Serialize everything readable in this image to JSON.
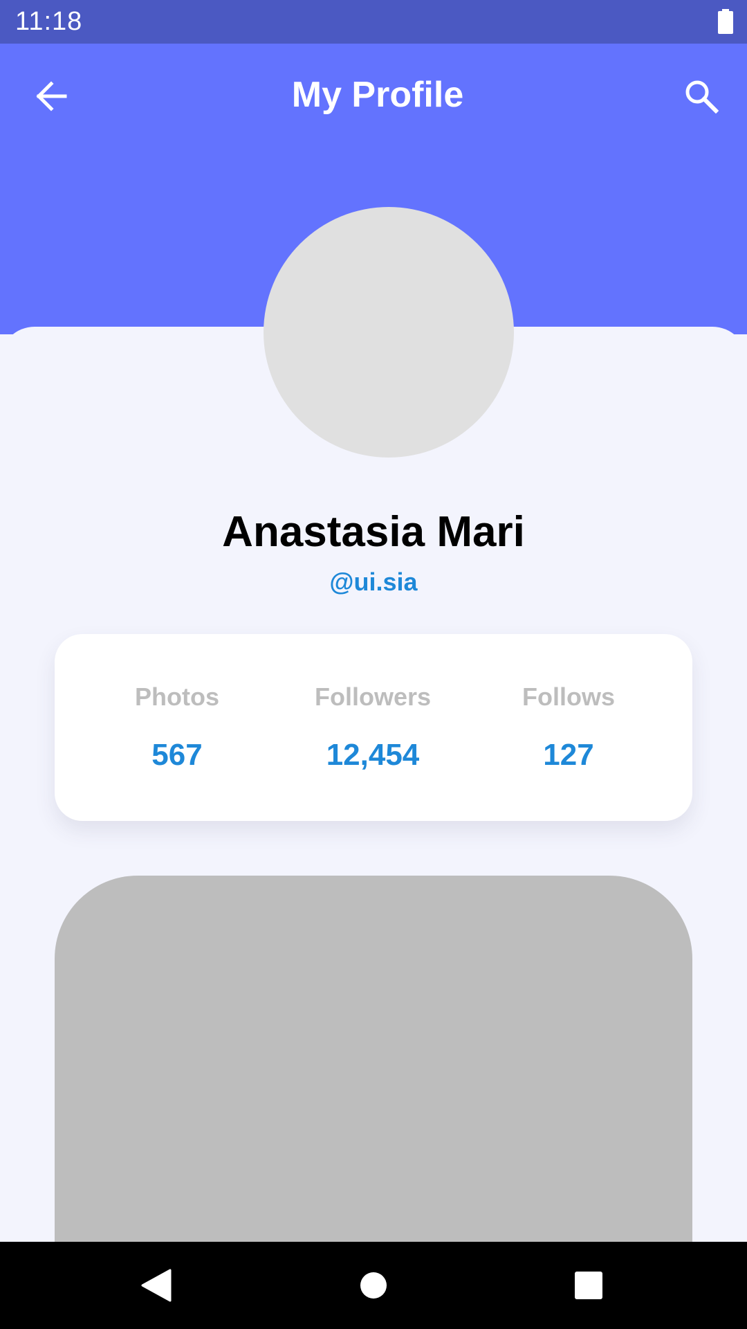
{
  "status_bar": {
    "time": "11:18",
    "battery_icon": "battery-full-icon"
  },
  "header": {
    "title": "My Profile",
    "back_icon": "arrow-back-icon",
    "search_icon": "search-icon",
    "background_color": "#6373FE"
  },
  "profile": {
    "name": "Anastasia Mari",
    "handle": "@ui.sia"
  },
  "stats": [
    {
      "label": "Photos",
      "value": "567"
    },
    {
      "label": "Followers",
      "value": "12,454"
    },
    {
      "label": "Follows",
      "value": "127"
    }
  ],
  "nav_bar": {
    "back_icon": "nav-back-triangle-icon",
    "home_icon": "nav-home-circle-icon",
    "recents_icon": "nav-recents-square-icon"
  },
  "colors": {
    "status_bar": "#4B59C2",
    "accent": "#1E88D8",
    "stat_label": "#BDBDBD",
    "background": "#F3F4FD"
  }
}
